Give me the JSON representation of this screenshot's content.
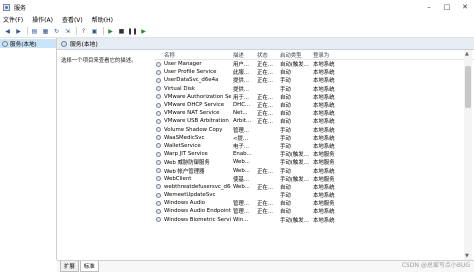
{
  "window": {
    "title": "服务",
    "controls": [
      "–",
      "□",
      "✕"
    ]
  },
  "menu": [
    "文件(F)",
    "操作(A)",
    "查看(V)",
    "帮助(H)"
  ],
  "tree": {
    "item": "服务(本地)"
  },
  "header": {
    "title": "服务(本地)"
  },
  "description_hint": "选择一个项目来查看它的描述。",
  "columns": {
    "name": "名称",
    "desc": "描述",
    "status": "状态",
    "startup": "启动类型",
    "logon": "登录为"
  },
  "services": [
    {
      "name": "User Manager",
      "desc": "用户...",
      "status": "正在...",
      "startup": "自动(触发...",
      "logon": "本地系统"
    },
    {
      "name": "User Profile Service",
      "desc": "此服...",
      "status": "正在...",
      "startup": "自动",
      "logon": "本地系统"
    },
    {
      "name": "UserDataSvc_d6e4a",
      "desc": "提供...",
      "status": "正在...",
      "startup": "手动",
      "logon": "本地系统"
    },
    {
      "name": "Virtual Disk",
      "desc": "提供...",
      "status": "",
      "startup": "手动",
      "logon": "本地系统"
    },
    {
      "name": "VMware Authorization Ser...",
      "desc": "用于...",
      "status": "正在...",
      "startup": "自动",
      "logon": "本地系统"
    },
    {
      "name": "VMware DHCP Service",
      "desc": "DHC...",
      "status": "正在...",
      "startup": "自动",
      "logon": "本地系统"
    },
    {
      "name": "VMware NAT Service",
      "desc": "Net...",
      "status": "正在...",
      "startup": "自动",
      "logon": "本地系统"
    },
    {
      "name": "VMware USB Arbitration S...",
      "desc": "Arbit...",
      "status": "正在...",
      "startup": "自动",
      "logon": "本地系统"
    },
    {
      "name": "Volume Shadow Copy",
      "desc": "管理...",
      "status": "",
      "startup": "手动",
      "logon": "本地系统"
    },
    {
      "name": "WaaSMedicSvc",
      "desc": "<提...",
      "status": "",
      "startup": "手动",
      "logon": "本地系统"
    },
    {
      "name": "WalletService",
      "desc": "电子...",
      "status": "",
      "startup": "手动",
      "logon": "本地系统"
    },
    {
      "name": "Warp JIT Service",
      "desc": "Enab...",
      "status": "",
      "startup": "手动(触发...",
      "logon": "本地服务"
    },
    {
      "name": "Web 威胁防御服务",
      "desc": "Web...",
      "status": "",
      "startup": "手动(触发...",
      "logon": "本地服务"
    },
    {
      "name": "Web 帐户管理器",
      "desc": "Web...",
      "status": "正在...",
      "startup": "手动",
      "logon": "本地系统"
    },
    {
      "name": "WebClient",
      "desc": "使基...",
      "status": "",
      "startup": "手动(触发...",
      "logon": "本地服务"
    },
    {
      "name": "webthreatdefusersvc_d6e4a",
      "desc": "Web...",
      "status": "正在...",
      "startup": "自动",
      "logon": "本地系统"
    },
    {
      "name": "WemeetUpdateSvc",
      "desc": "",
      "status": "",
      "startup": "手动",
      "logon": "本地系统"
    },
    {
      "name": "Windows Audio",
      "desc": "管理...",
      "status": "正在...",
      "startup": "自动",
      "logon": "本地服务"
    },
    {
      "name": "Windows Audio Endpoint B...",
      "desc": "管理...",
      "status": "正在...",
      "startup": "自动",
      "logon": "本地系统"
    },
    {
      "name": "Windows Biometric Service",
      "desc": "Win...",
      "status": "",
      "startup": "手动(触发...",
      "logon": "本地系统"
    }
  ],
  "tabs": [
    "扩展",
    "标准"
  ],
  "watermark": "CSDN @总爱写点小BUG"
}
